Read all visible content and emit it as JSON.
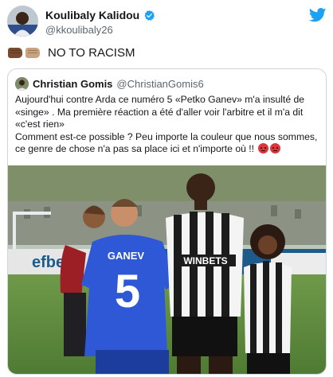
{
  "tweet": {
    "display_name": "Koulibaly Kalidou",
    "handle": "@kkoulibaly26",
    "text": "NO TO RACISM",
    "emoji": [
      "dark-skin-fist",
      "light-skin-fist"
    ]
  },
  "quoted_tweet": {
    "display_name": "Christian Gomis",
    "handle": "@ChristianGomis6",
    "paragraphs": [
      "Aujourd'hui contre Arda ce numéro 5 «Petko Ganev» m'a insulté de «singe» . Ma première réaction a été d'aller voir l'arbitre et il m'a dit «c'est rien»",
      "Comment est-ce possible ? Peu importe la couleur que nous sommes, ce genre de chose n'a pas sa place ici et n'importe où !!"
    ],
    "emoji": [
      "angry-face",
      "angry-face"
    ],
    "photo": {
      "jersey_name": "GANEV",
      "jersey_number": "5",
      "sponsor_text": "WINBETS",
      "board_text": "efbet"
    }
  },
  "colors": {
    "text": "#14171a",
    "secondary": "#5b6770",
    "border": "#ccd6dd",
    "twitter_blue": "#1da1f2"
  }
}
